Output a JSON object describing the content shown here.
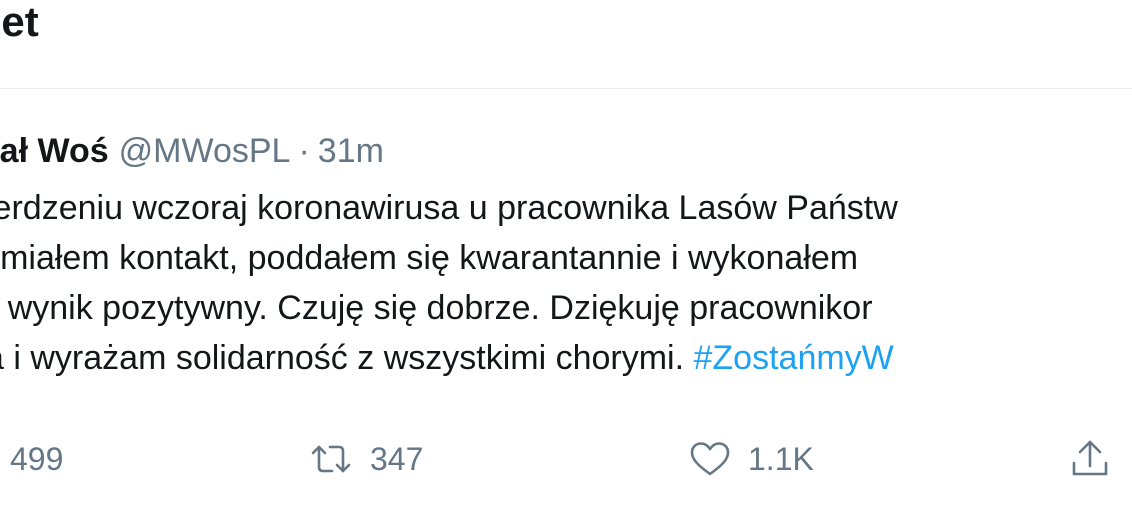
{
  "header": {
    "title": "eet"
  },
  "tweet": {
    "author_name": "chał Woś",
    "author_handle": "@MWosPL",
    "separator": "·",
    "timestamp": "31m",
    "lines": [
      "stwierdzeniu wczoraj koronawirusa u pracownika Lasów Państw",
      "rym miałem kontakt, poddałem się kwarantannie i wykonałem",
      "t dał wynik pozytywny. Czuję się dobrze. Dziękuję pracownikor",
      "owia i wyrażam solidarność z wszystkimi chorymi. "
    ],
    "hashtag": "#ZostańmyW"
  },
  "actions": {
    "reply_count": "499",
    "retweet_count": "347",
    "like_count": "1.1K",
    "icons": {
      "retweet": "retweet-icon",
      "like": "heart-icon",
      "share": "share-icon"
    }
  }
}
